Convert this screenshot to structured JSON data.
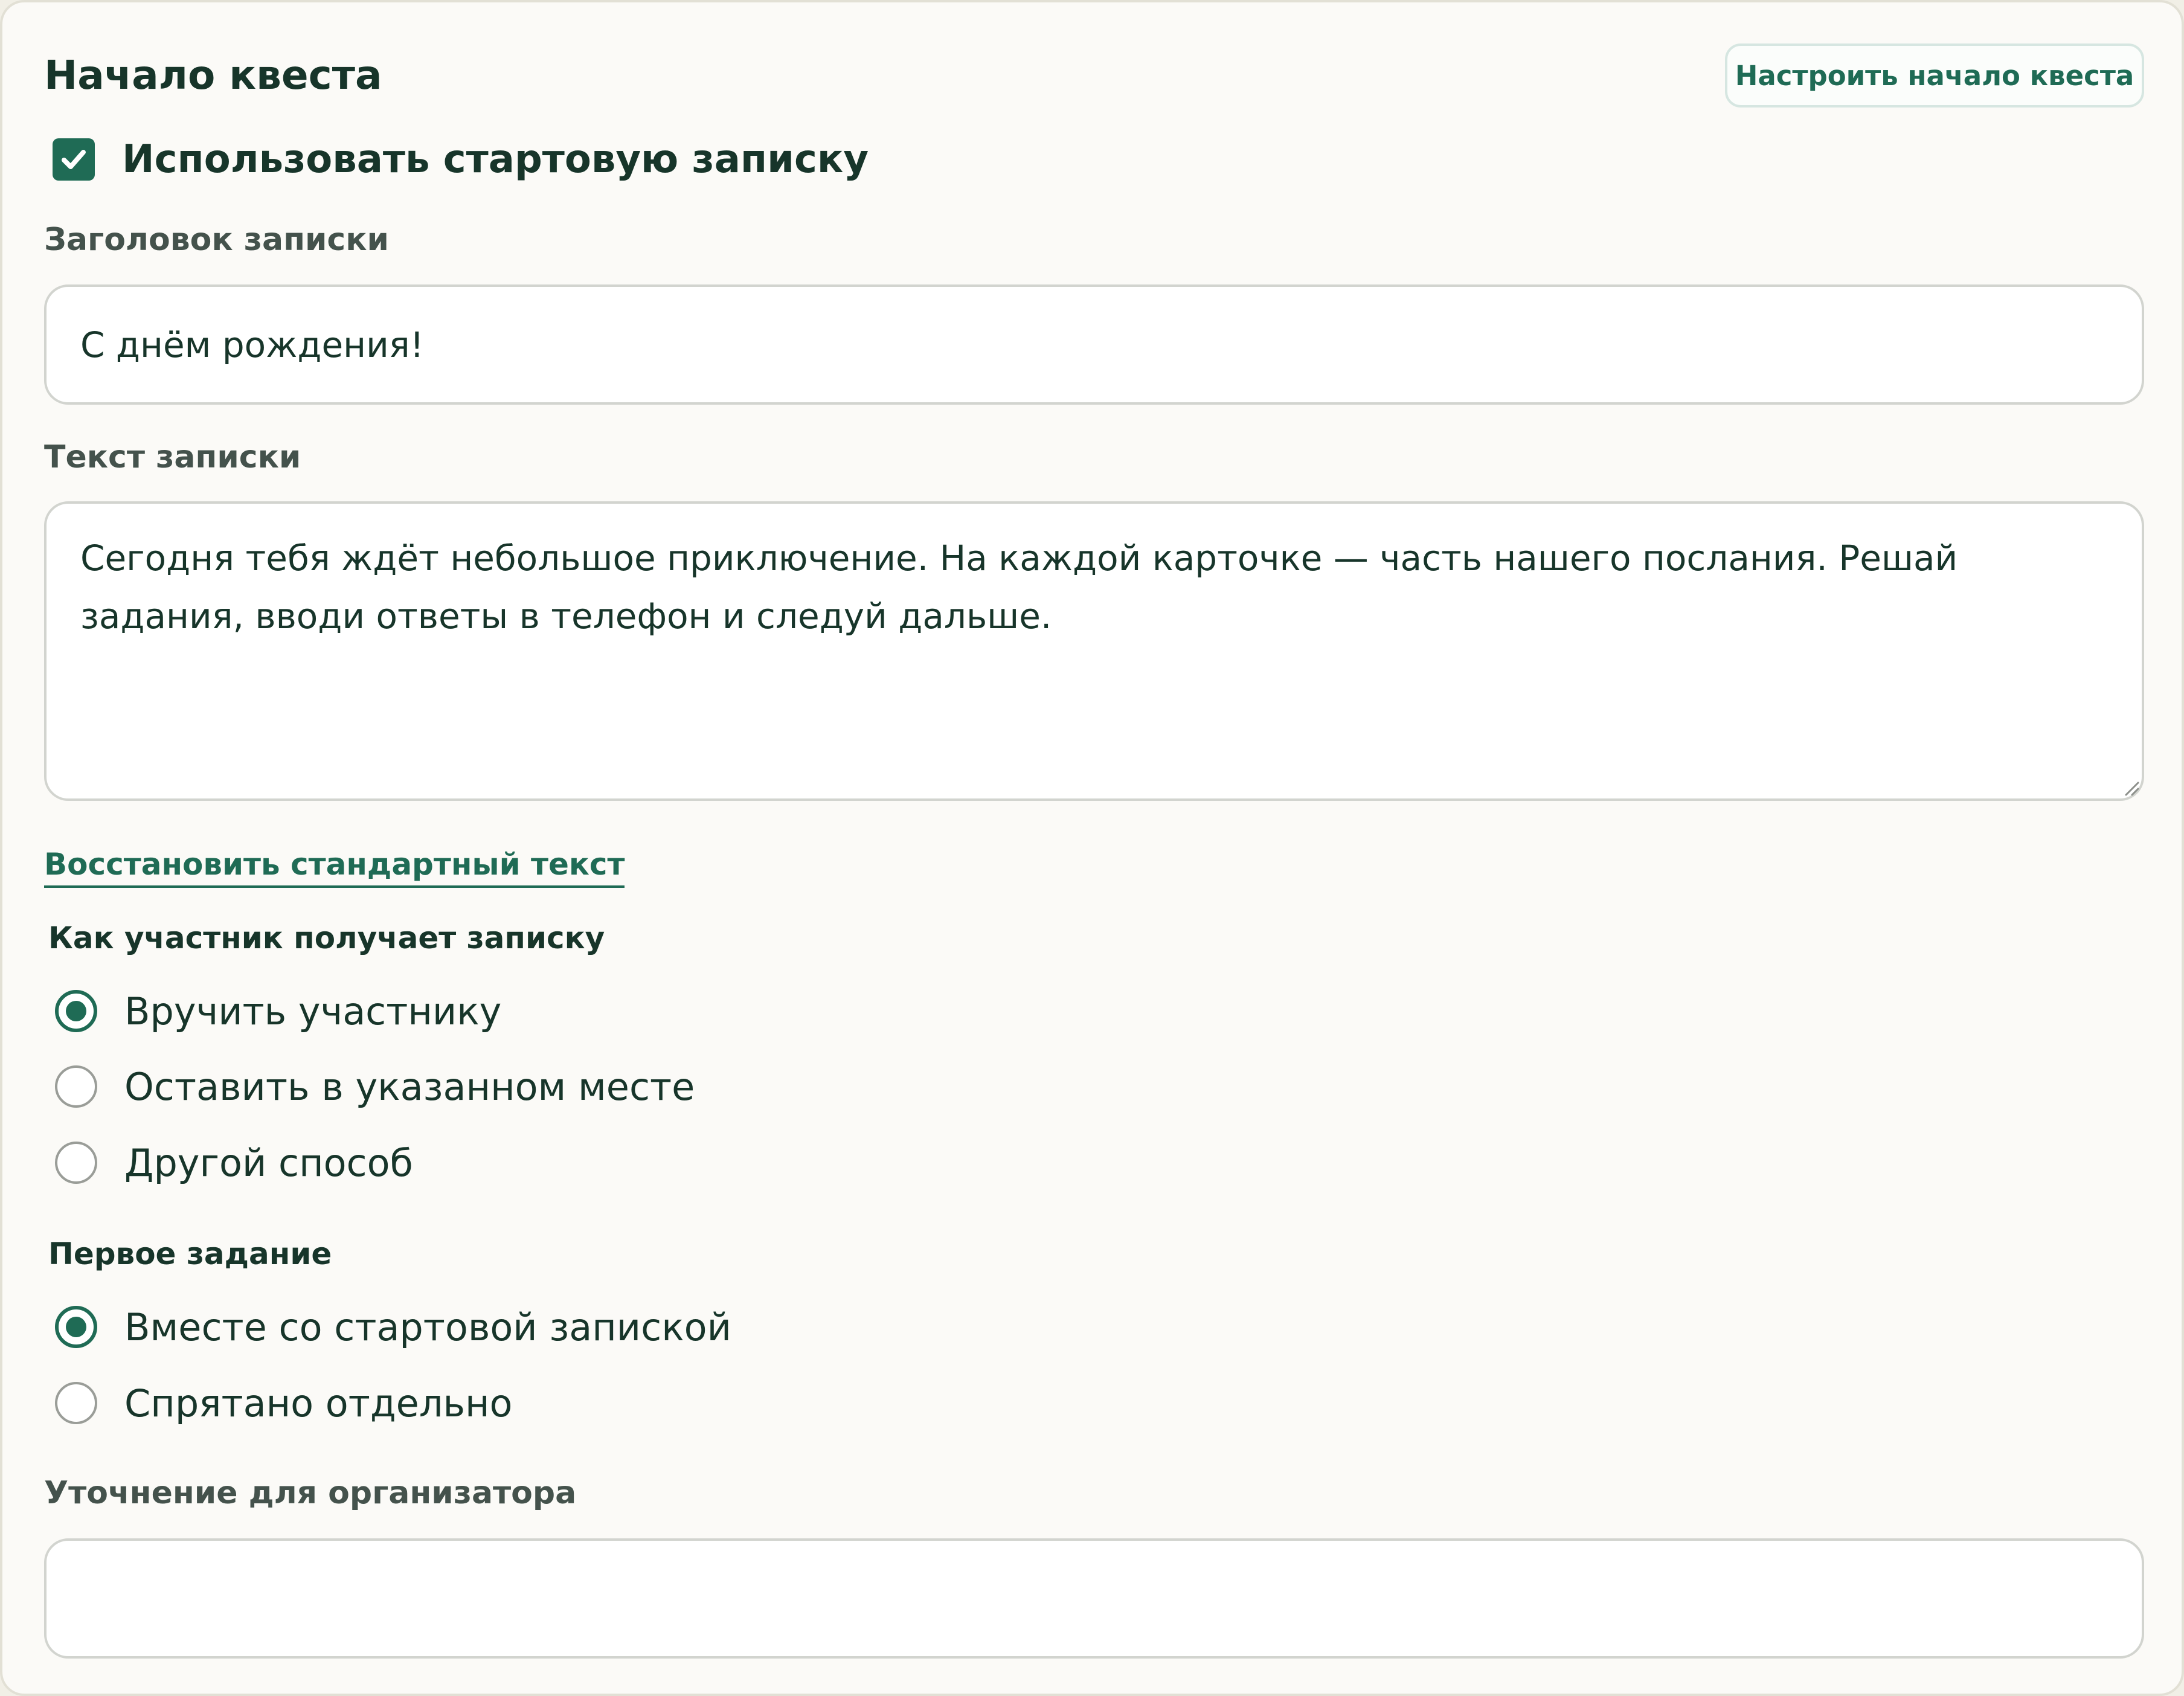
{
  "section": {
    "title": "Начало квеста",
    "config_button_label": "Настроить начало квеста"
  },
  "start_note": {
    "use_label": "Использовать стартовую записку",
    "use_checked": true,
    "title_label": "Заголовок записки",
    "title_value": "С днём рождения!",
    "text_label": "Текст записки",
    "text_value": "Сегодня тебя ждёт небольшое приключение. На каждой карточке — часть нашего послания. Решай задания, вводи ответы в телефон и следуй дальше.",
    "restore_link": "Восстановить стандартный текст"
  },
  "delivery": {
    "label": "Как участник получает записку",
    "options": [
      {
        "label": "Вручить участнику",
        "selected": true
      },
      {
        "label": "Оставить в указанном месте",
        "selected": false
      },
      {
        "label": "Другой способ",
        "selected": false
      }
    ]
  },
  "first_task": {
    "label": "Первое задание",
    "options": [
      {
        "label": "Вместе со стартовой запиской",
        "selected": true
      },
      {
        "label": "Спрятано отдельно",
        "selected": false
      }
    ]
  },
  "organizer_note": {
    "label": "Уточнение для организатора",
    "value": ""
  },
  "colors": {
    "accent": "#1f6b55",
    "text": "#17352a",
    "muted_label": "#44524c",
    "card_bg": "#fbfaf7",
    "page_bg": "#f1efe6",
    "input_border": "#d2d4cf"
  }
}
